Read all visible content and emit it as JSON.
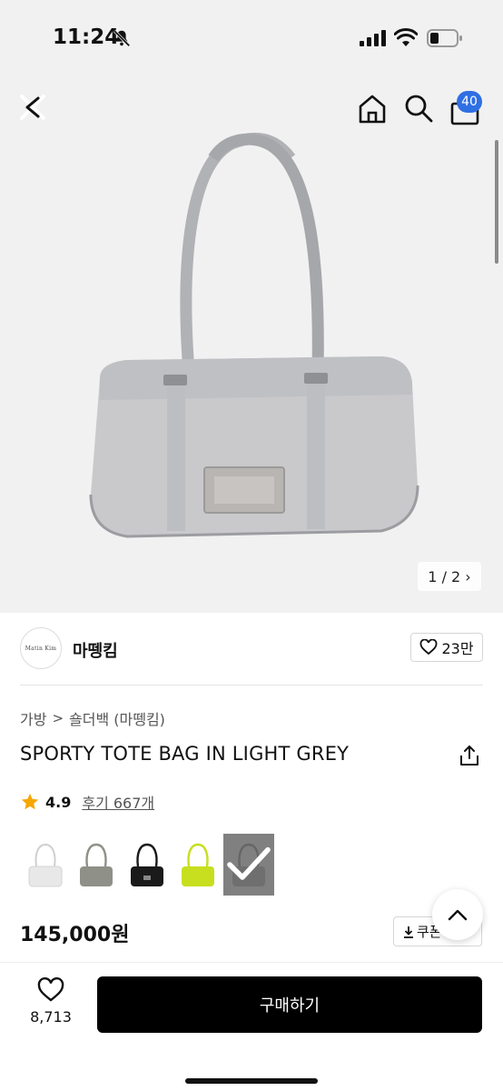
{
  "status_bar": {
    "time": "11:24"
  },
  "header": {
    "cart_count": "40",
    "icons": [
      "close-back-icon",
      "home-icon",
      "search-icon",
      "cart-icon"
    ]
  },
  "gallery": {
    "counter": "1 / 2 ›",
    "current": 1,
    "total": 2
  },
  "brand": {
    "logo_text": "Matin Kim",
    "name": "마뗑킴",
    "like_count": "23만"
  },
  "breadcrumb": {
    "items": [
      "가방",
      "숄더백 (마뗑킴)"
    ],
    "separator": ">"
  },
  "product": {
    "title": "SPORTY TOTE BAG IN LIGHT GREY",
    "rating": "4.9",
    "review_label": "후기 667개",
    "price": "145,000원",
    "coupon_label": "쿠폰"
  },
  "swatches": [
    {
      "name": "white",
      "color": "#e8e8e8",
      "selected": false
    },
    {
      "name": "grey",
      "color": "#8f9088",
      "selected": false
    },
    {
      "name": "black",
      "color": "#1a1a1a",
      "selected": false
    },
    {
      "name": "lime",
      "color": "#c7df1e",
      "selected": false
    },
    {
      "name": "light-grey",
      "color": "#6f6f6f",
      "selected": true
    }
  ],
  "bottom_bar": {
    "wishlist_count": "8,713",
    "buy_label": "구매하기"
  },
  "colors": {
    "badge": "#2f6fe4",
    "star": "#f6a700",
    "buy_button": "#000000"
  }
}
